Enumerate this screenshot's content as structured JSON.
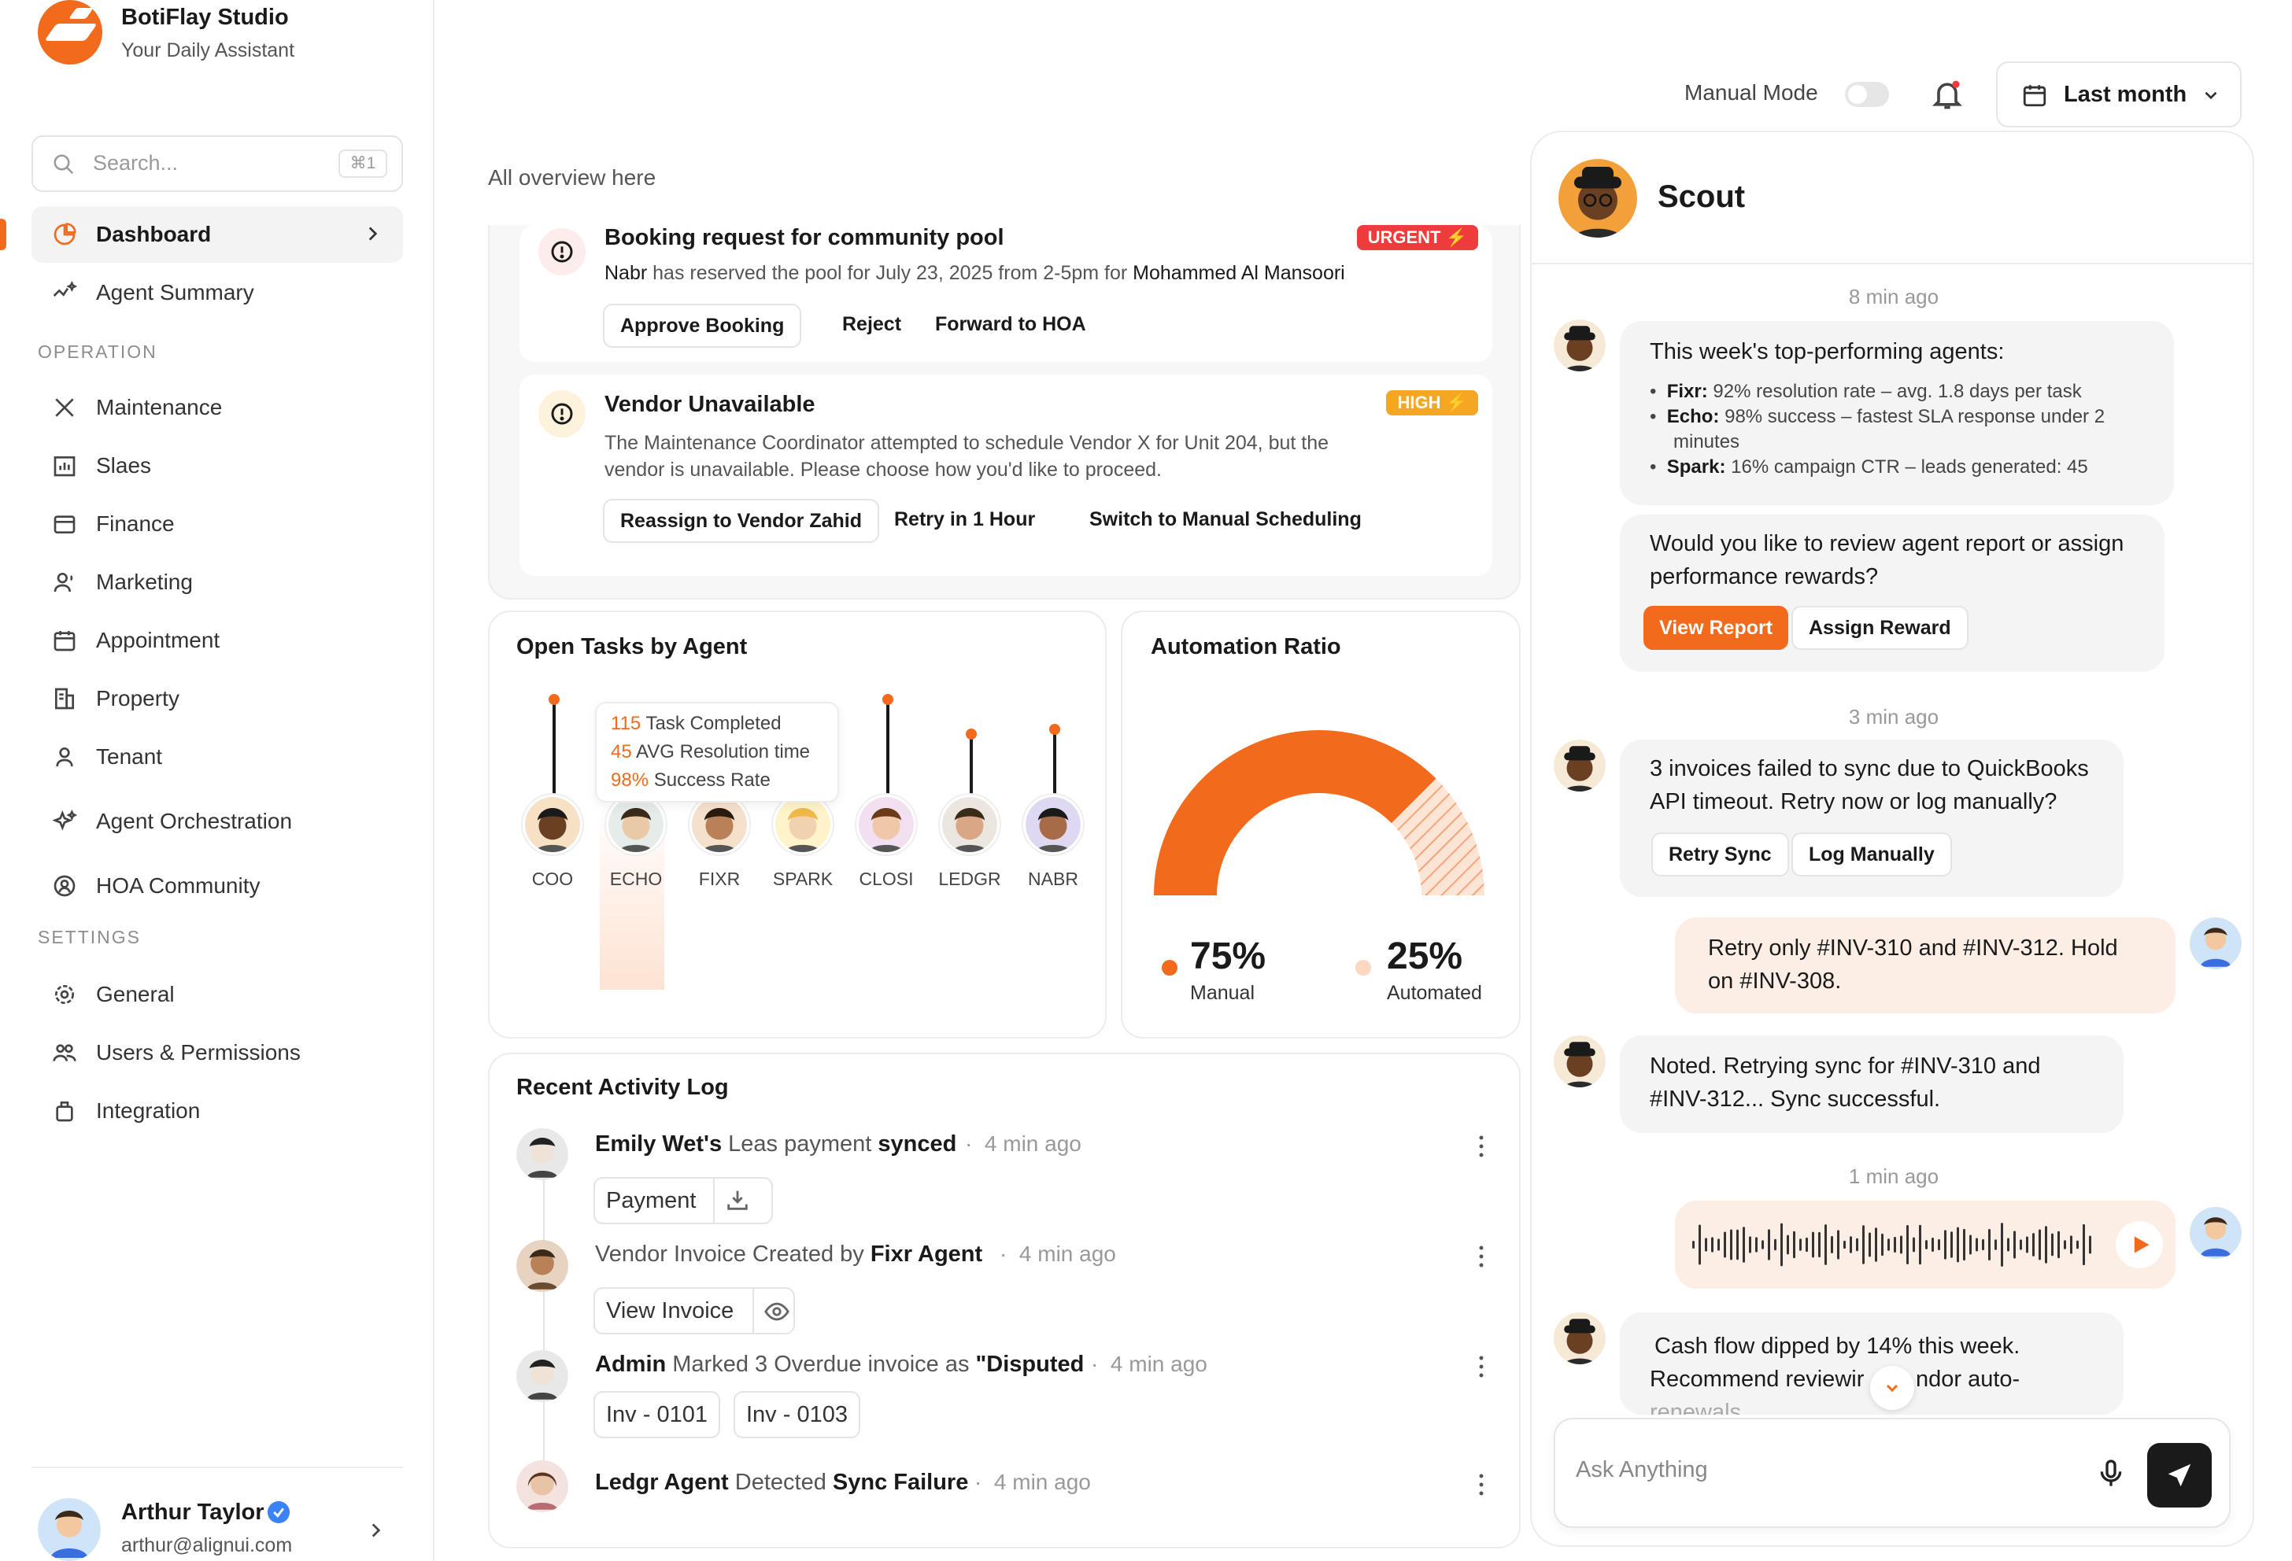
{
  "app": {
    "name": "BotiFlay Studio",
    "subtitle": "Your Daily Assistant"
  },
  "search": {
    "placeholder": "Search...",
    "shortcut": "⌘1"
  },
  "nav": {
    "dashboard": "Dashboard",
    "agent_summary": "Agent Summary",
    "operation_header": "OPERATION",
    "operation": [
      "Maintenance",
      "Slaes",
      "Finance",
      "Marketing",
      "Appointment",
      "Property",
      "Tenant"
    ],
    "agent_orchestration": "Agent Orchestration",
    "hoa_community": "HOA Community",
    "settings_header": "SETTINGS",
    "settings": [
      "General",
      "Users & Permissions",
      "Integration"
    ]
  },
  "user": {
    "name": "Arthur Taylor",
    "email": "arthur@alignui.com"
  },
  "topbar": {
    "manual_mode": "Manual Mode",
    "date_range": "Last month"
  },
  "overview_label": "All overview here",
  "notifications": [
    {
      "title": "Booking request for community pool",
      "badge": "URGENT ⚡",
      "desc_a": "Nabr",
      "desc_b": " has reserved the pool for July 23, 2025 from 2-5pm for ",
      "desc_c": "Mohammed Al Mansoori",
      "actions": [
        "Approve Booking",
        "Reject",
        "Forward to HOA"
      ]
    },
    {
      "title": "Vendor Unavailable",
      "badge": "HIGH ⚡",
      "desc_1": "The Maintenance Coordinator attempted to schedule Vendor X for Unit 204, but the",
      "desc_2": "vendor is unavailable. Please choose how you'd like to proceed.",
      "actions": [
        "Reassign to Vendor Zahid",
        "Retry in 1 Hour",
        "Switch to Manual Scheduling"
      ]
    }
  ],
  "open_tasks": {
    "title": "Open Tasks by Agent",
    "agents": [
      "COO",
      "ECHO",
      "FIXR",
      "SPARK",
      "CLOSI",
      "LEDGR",
      "NABR"
    ],
    "tooltip": {
      "tasks_value": "115",
      "tasks_label": "Task Completed",
      "avg_value": "45",
      "avg_label": "AVG Resolution time",
      "rate_value": "98%",
      "rate_label": "Success Rate"
    }
  },
  "automation": {
    "title": "Automation Ratio",
    "manual_value": "75%",
    "manual_label": "Manual",
    "automated_value": "25%",
    "automated_label": "Automated",
    "manual_fraction": 0.75
  },
  "activity": {
    "title": "Recent Activity Log",
    "items": [
      {
        "a": "Emily Wet's",
        "b": " Leas payment ",
        "c": "synced",
        "time": "4 min ago",
        "chips": [
          "Payment"
        ]
      },
      {
        "a": "",
        "b": "Vendor Invoice Created by ",
        "c": "Fixr Agent",
        "time": "4 min ago",
        "chips": [
          "View Invoice"
        ]
      },
      {
        "a": "Admin",
        "b": " Marked 3 Overdue invoice as ",
        "c": "\"Disputed",
        "time": "4 min ago",
        "chips": [
          "Inv - 0101",
          "Inv - 0103"
        ]
      },
      {
        "a": "Ledgr Agent",
        "b": " Detected ",
        "c": "Sync Failure",
        "time": "4 min ago",
        "chips": []
      }
    ]
  },
  "chat": {
    "name": "Scout",
    "t1": "8 min ago",
    "m1_title": "This week's top-performing agents:",
    "m1_bullets": [
      {
        "k": "Fixr:",
        "v": " 92% resolution rate – avg. 1.8 days per task"
      },
      {
        "k": "Echo:",
        "v": " 98% success – fastest SLA response under 2"
      },
      {
        "k": "",
        "v": "minutes"
      },
      {
        "k": "Spark:",
        "v": " 16% campaign CTR – leads generated: 45"
      }
    ],
    "m2_1": "Would you like to review agent report or assign",
    "m2_2": "performance rewards?",
    "m2_actions": [
      "View Report",
      "Assign Reward"
    ],
    "t2": "3 min ago",
    "m3_1": "3 invoices failed to sync due to QuickBooks",
    "m3_2": "API timeout. Retry now or log manually?",
    "m3_actions": [
      "Retry Sync",
      "Log Manually"
    ],
    "u1_1": "Retry only #INV-310 and #INV-312. Hold",
    "u1_2": "on #INV-308.",
    "m4_1": "Noted. Retrying sync for #INV-310 and",
    "m4_2": "#INV-312... Sync successful.",
    "t3": "1 min ago",
    "m5_1": "Cash flow dipped by 14% this week.",
    "m5_2": "Recommend reviewir",
    "m5_3": "ndor auto-",
    "m5_4": "renewals.",
    "input_placeholder": "Ask Anything"
  },
  "colors": {
    "accent": "#f26a1b",
    "urgent": "#ef3b3b",
    "high": "#f5a623"
  }
}
